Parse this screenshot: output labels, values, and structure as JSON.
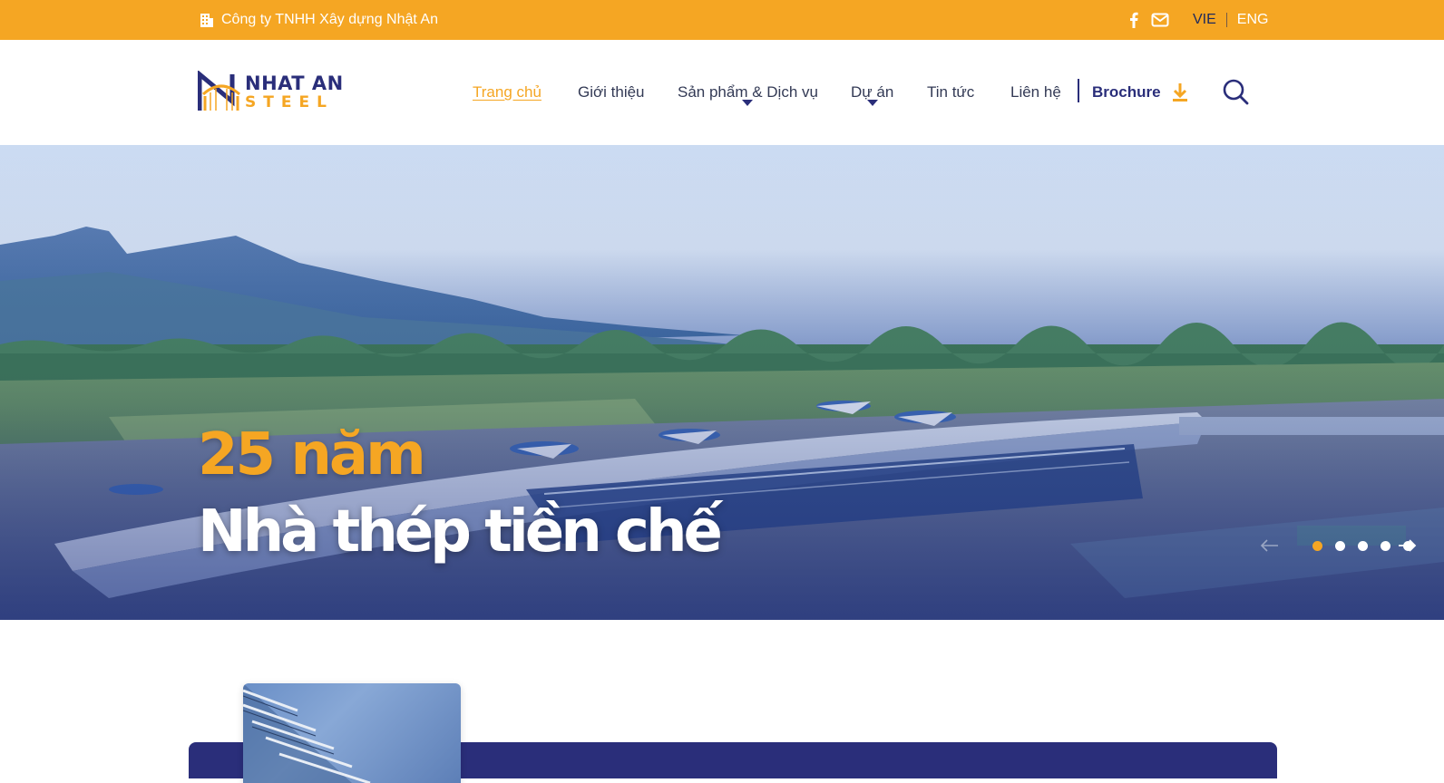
{
  "topbar": {
    "company_name": "Công ty TNHH Xây dựng Nhật An",
    "building_icon": "building-icon",
    "facebook_icon": "facebook-icon",
    "mail_icon": "mail-icon",
    "lang_vie": "VIE",
    "lang_eng": "ENG",
    "bg_color": "#f5a623"
  },
  "header": {
    "logo_line1": "NHAT AN",
    "logo_line2": "STEEL",
    "nav": [
      {
        "label": "Trang chủ",
        "active": true
      },
      {
        "label": "Giới thiệu"
      },
      {
        "label": "Sản phẩm & Dịch vụ",
        "has_dropdown": true
      },
      {
        "label": "Dự án",
        "has_dropdown": true
      },
      {
        "label": "Tin tức"
      },
      {
        "label": "Liên hệ"
      }
    ],
    "brochure_label": "Brochure",
    "download_icon": "download-icon",
    "search_icon": "search-icon"
  },
  "hero": {
    "headline_1": "25 năm",
    "headline_2": "Nhà thép tiền chế",
    "slides_total": 5,
    "active_slide": 1,
    "accent_color": "#f5a623",
    "primary_color": "#2a2e7a"
  }
}
